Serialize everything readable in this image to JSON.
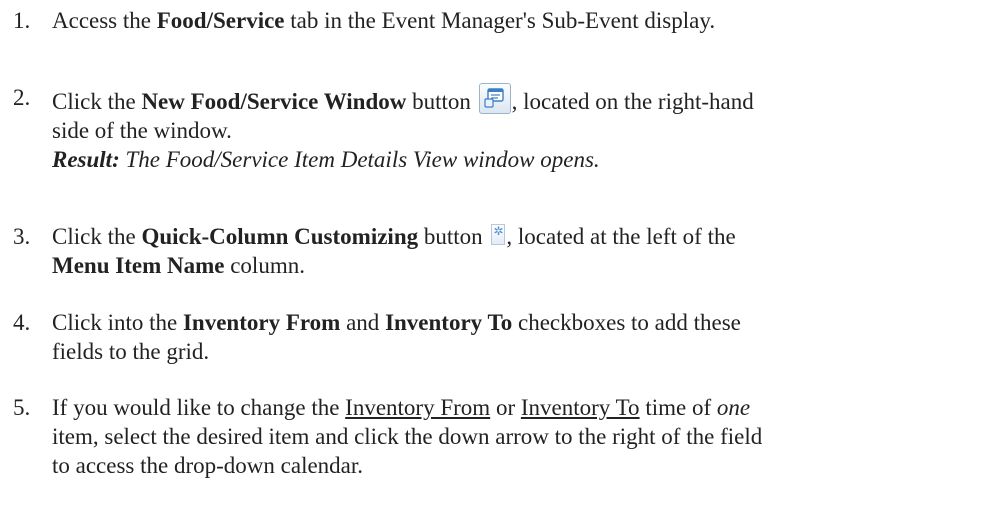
{
  "steps": [
    {
      "num": "1.",
      "t1": "Access the ",
      "b1": "Food/Service",
      "t2": " tab in the Event Manager's Sub-Event display."
    },
    {
      "num": "2.",
      "t1": "Click the ",
      "b1": "New Food/Service Window",
      "t2": " button ",
      "icon": "new-window-icon",
      "t3": ", located on the right-hand",
      "line2": "side of the window.",
      "result_label": "Result:",
      "result_text": " The Food/Service Item Details View window opens."
    },
    {
      "num": "3.",
      "t1": "Click the ",
      "b1": "Quick-Column Customizing",
      "t2": " button ",
      "icon": "quick-column-icon",
      "t3": ", located at the left of the",
      "b2": "Menu Item Name",
      "t4": " column."
    },
    {
      "num": "4.",
      "t1": "Click into the ",
      "b1": "Inventory From",
      "t2": " and ",
      "b2": "Inventory To",
      "t3": " checkboxes to add these",
      "line2": "fields to the grid."
    },
    {
      "num": "5.",
      "t1": "If you would like to change the ",
      "u1": "Inventory From",
      "t2": " or ",
      "u2": "Inventory To",
      "t3": " time of ",
      "i1": "one",
      "line2": "item, select the desired item and click the down arrow to the right of the field",
      "line3": "to access the drop-down calendar."
    }
  ]
}
